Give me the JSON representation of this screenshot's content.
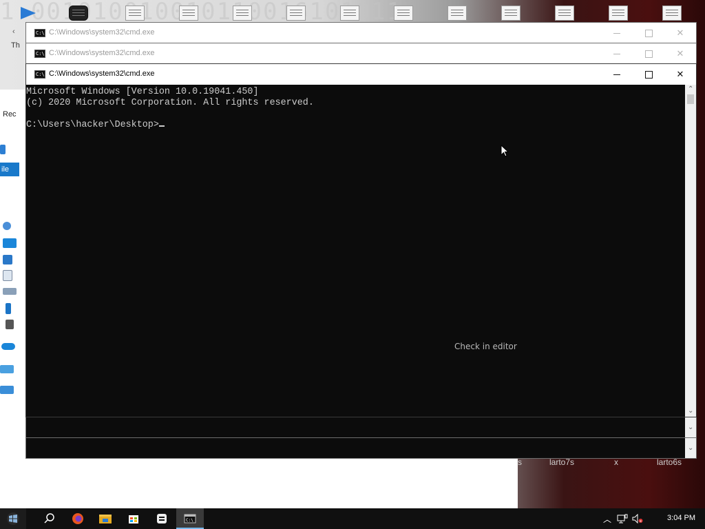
{
  "desktop": {
    "binary_text": "1 001010010010110016101011",
    "explorer": {
      "labels": [
        "‹",
        "Th",
        "Rec",
        "ile"
      ],
      "file_tab": "ile"
    },
    "bottom_labels": [
      "s",
      "larto7s",
      "x",
      "larto6s"
    ]
  },
  "windows": [
    {
      "title": "C:\\Windows\\system32\\cmd.exe",
      "state": "inactive"
    },
    {
      "title": "C:\\Windows\\system32\\cmd.exe",
      "state": "inactive"
    },
    {
      "title": "C:\\Windows\\system32\\cmd.exe",
      "state": "active"
    }
  ],
  "console": {
    "line1": "Microsoft Windows [Version 10.0.19041.450]",
    "line2": "(c) 2020 Microsoft Corporation. All rights reserved.",
    "line3": "",
    "prompt": "C:\\Users\\hacker\\Desktop>"
  },
  "overlay": {
    "check_in_editor": "Check in editor"
  },
  "taskbar": {
    "clock": "3:04 PM",
    "items": [
      "start-button",
      "search-icon",
      "firefox-icon",
      "file-explorer-icon",
      "store-icon",
      "app-icon",
      "cmd-icon"
    ]
  },
  "colors": {
    "console_bg": "#0c0c0c",
    "console_fg": "#cccccc",
    "taskbar_bg": "#101010",
    "accent": "#76b9ed"
  }
}
